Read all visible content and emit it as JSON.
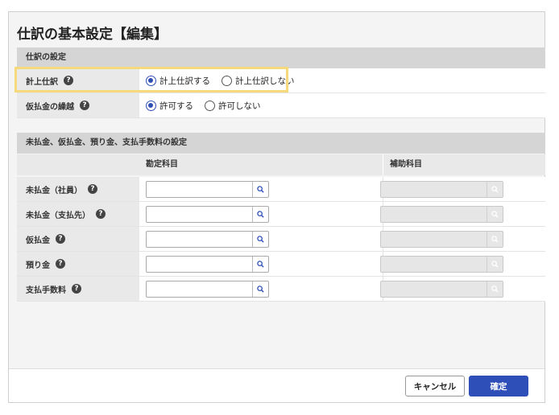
{
  "title": "仕訳の基本設定【編集】",
  "section1": {
    "heading": "仕訳の設定",
    "rows": [
      {
        "label": "計上仕訳",
        "options": [
          "計上仕訳する",
          "計上仕訳しない"
        ],
        "selected": 0
      },
      {
        "label": "仮払金の繰越",
        "options": [
          "許可する",
          "許可しない"
        ],
        "selected": 0
      }
    ]
  },
  "section2": {
    "heading": "未払金、仮払金、預り金、支払手数料の設定",
    "columns": [
      "勘定科目",
      "補助科目"
    ],
    "rows": [
      {
        "label": "未払金（社員）",
        "account": "",
        "sub_account": ""
      },
      {
        "label": "未払金（支払先）",
        "account": "",
        "sub_account": ""
      },
      {
        "label": "仮払金",
        "account": "",
        "sub_account": ""
      },
      {
        "label": "預り金",
        "account": "",
        "sub_account": ""
      },
      {
        "label": "支払手数料",
        "account": "",
        "sub_account": ""
      }
    ]
  },
  "help_glyph": "?",
  "buttons": {
    "cancel": "キャンセル",
    "confirm": "確定"
  },
  "colors": {
    "accent": "#2e4fb8",
    "highlight": "#f5d97a"
  }
}
